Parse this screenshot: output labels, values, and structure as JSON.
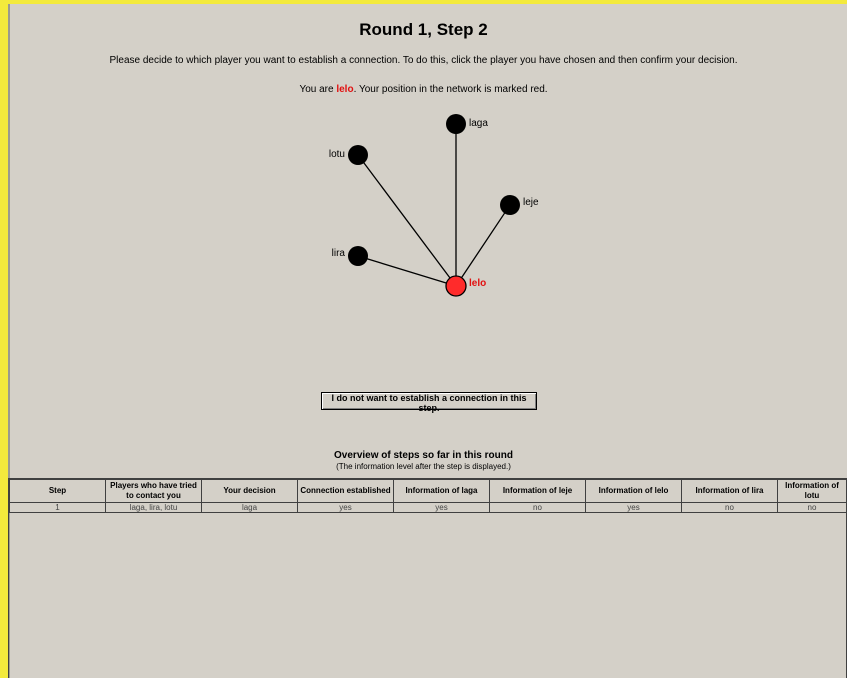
{
  "header": {
    "title": "Round 1, Step 2",
    "instruction": "Please decide to which player you want to establish a connection. To do this, click the player you have chosen and then confirm your decision.",
    "you_are_prefix": "You are ",
    "you_name": "lelo",
    "you_are_suffix": ". Your position in the network is marked red."
  },
  "network": {
    "nodes": [
      {
        "name": "laga",
        "self": false
      },
      {
        "name": "lotu",
        "self": false
      },
      {
        "name": "leje",
        "self": false
      },
      {
        "name": "lira",
        "self": false
      },
      {
        "name": "lelo",
        "self": true
      }
    ],
    "colors": {
      "player": "#000000",
      "self": "#ff2b2b",
      "self_label": "#e21010"
    }
  },
  "no_connection_button": "I do not want to establish a connection in this step.",
  "overview": {
    "title": "Overview of steps so far in this round",
    "subtitle": "(The information level after the step is displayed.)",
    "columns": [
      "Step",
      "Players who have tried to contact you",
      "Your decision",
      "Connection established",
      "Information of laga",
      "Information of leje",
      "Information of lelo",
      "Information of lira",
      "Information of lotu"
    ],
    "rows": [
      [
        "1",
        "laga, lira, lotu",
        "laga",
        "yes",
        "yes",
        "no",
        "yes",
        "no",
        "no"
      ]
    ]
  },
  "colors": {
    "background": "#d4d0c8",
    "frame": "#f3ea3c"
  }
}
